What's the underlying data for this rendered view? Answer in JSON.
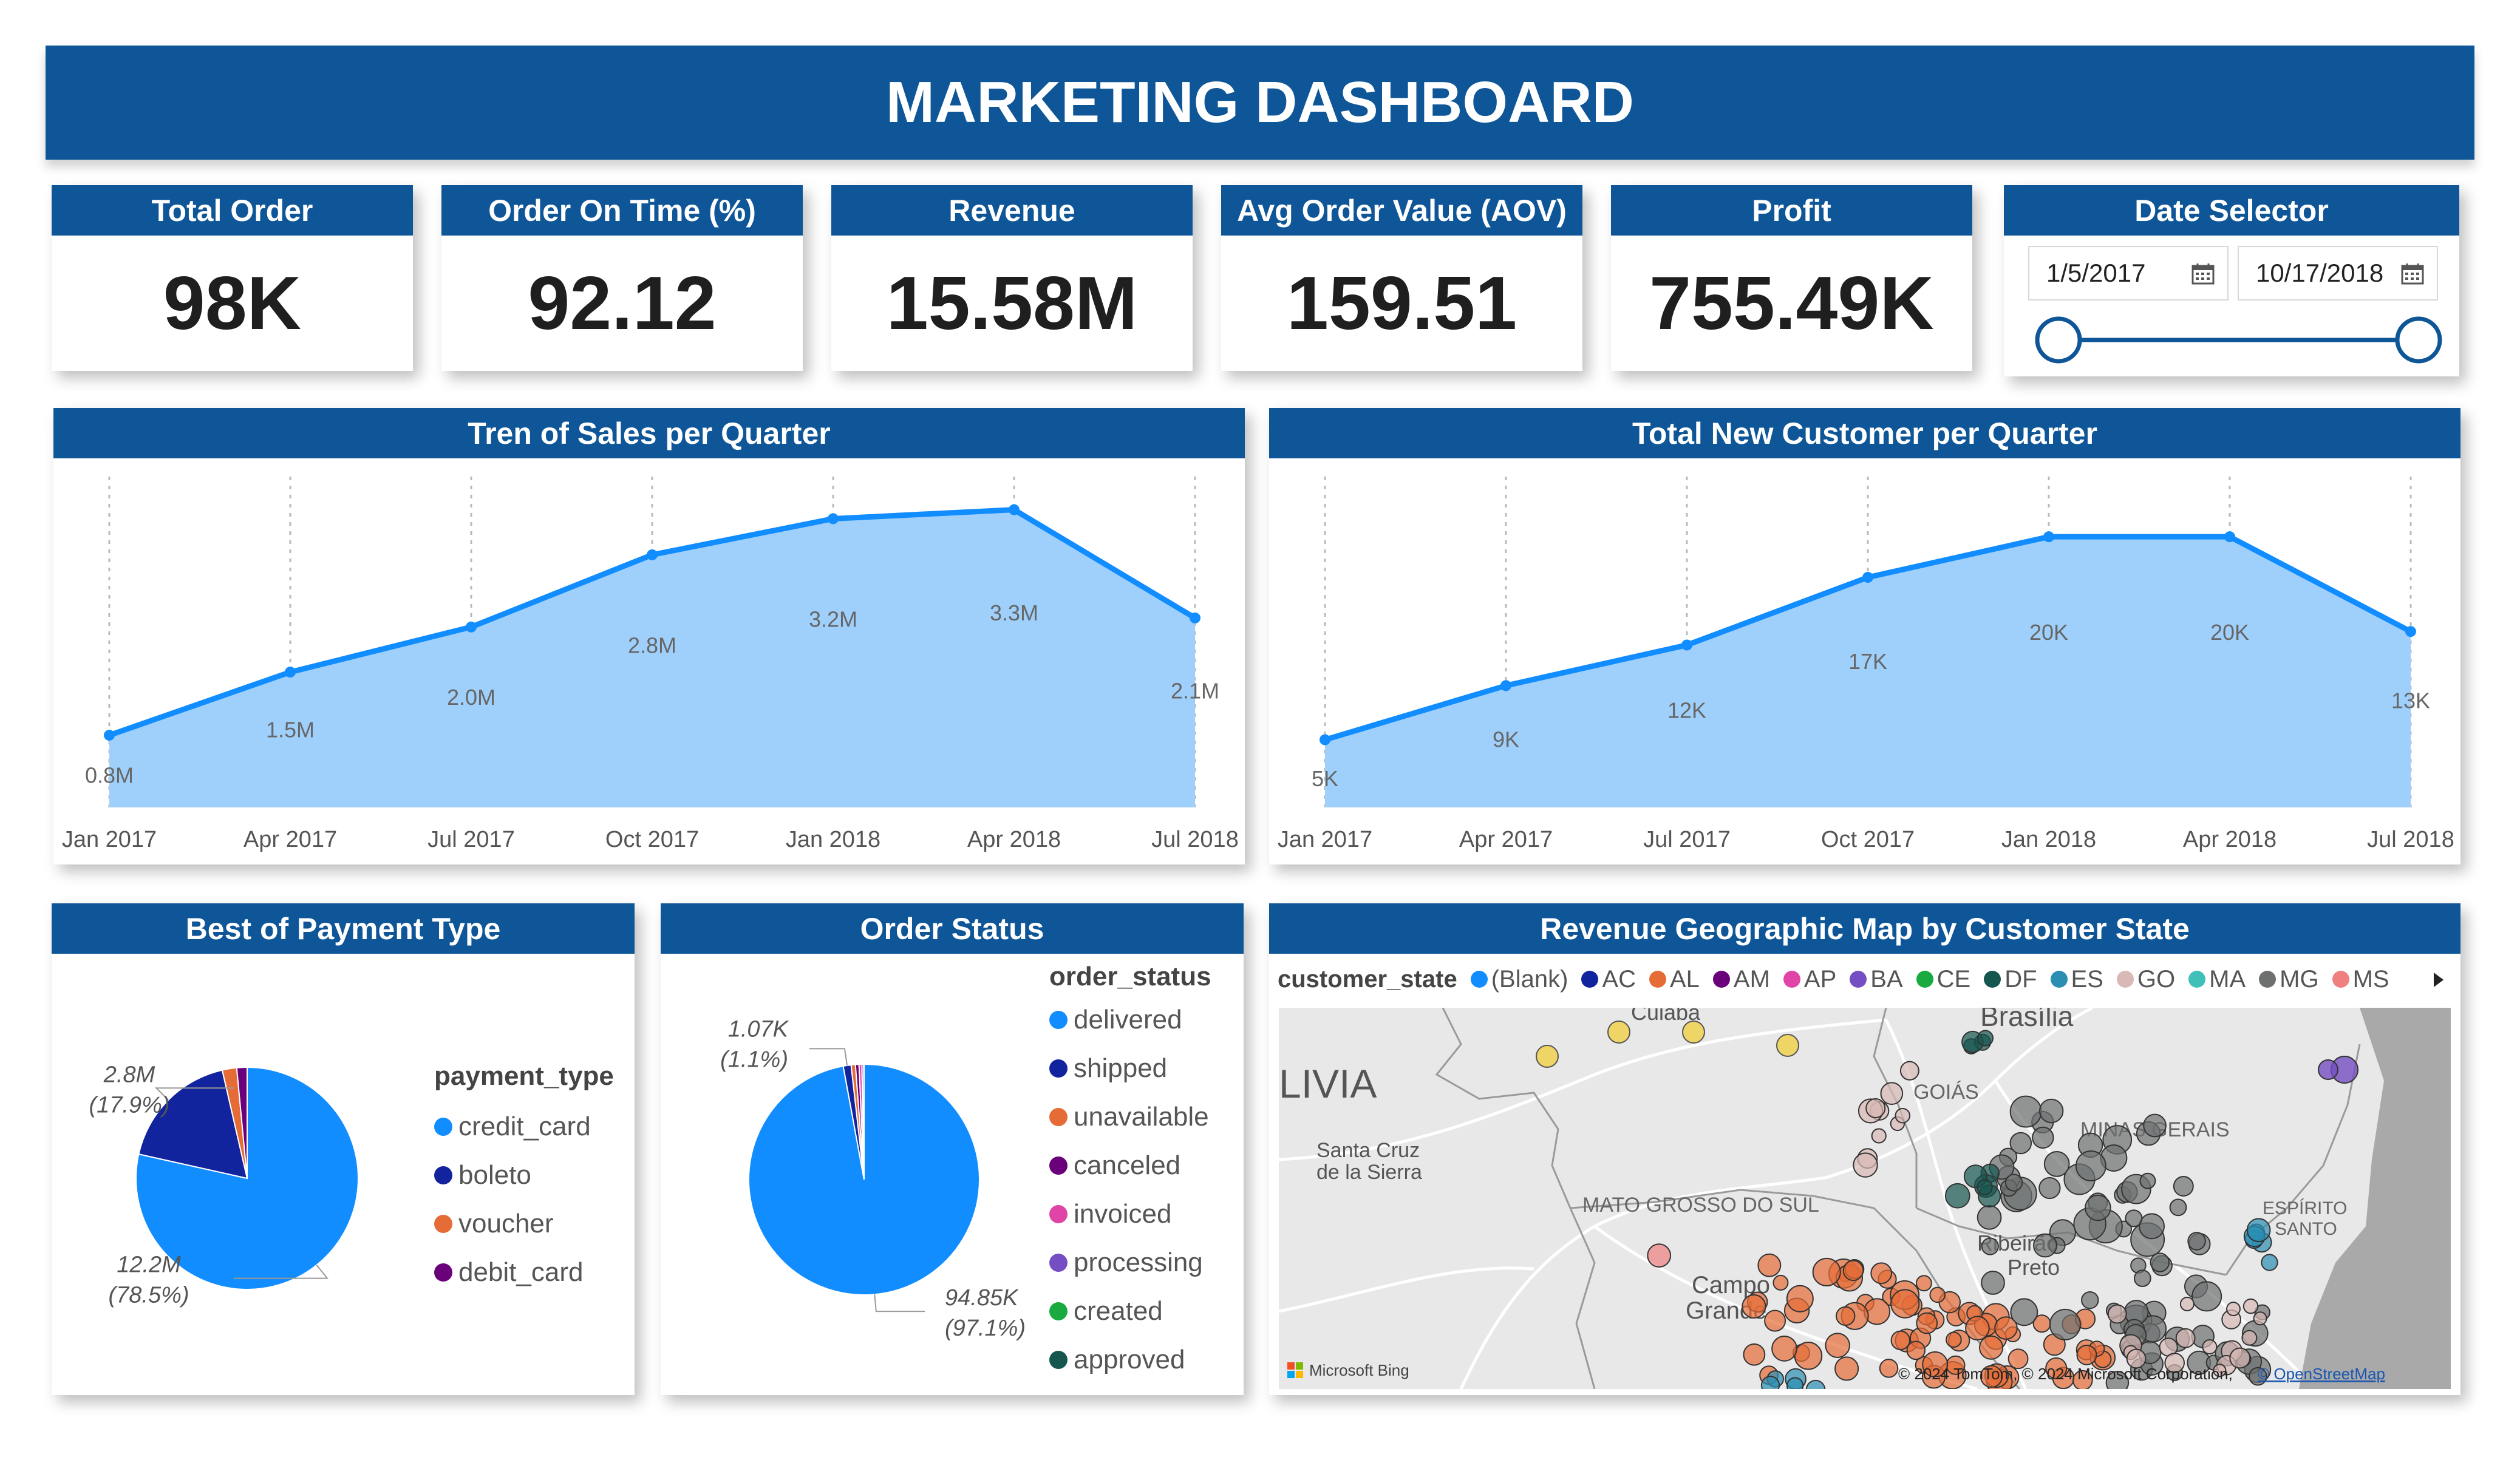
{
  "title": "MARKETING DASHBOARD",
  "kpis": [
    {
      "label": "Total Order",
      "value": "98K"
    },
    {
      "label": "Order On Time (%)",
      "value": "92.12"
    },
    {
      "label": "Revenue",
      "value": "15.58M"
    },
    {
      "label": "Avg Order Value (AOV)",
      "value": "159.51"
    },
    {
      "label": "Profit",
      "value": "755.49K"
    }
  ],
  "date_selector": {
    "label": "Date Selector",
    "start": "1/5/2017",
    "end": "10/17/2018",
    "icon": "calendar-icon"
  },
  "sales_chart": {
    "title": "Tren of Sales per Quarter"
  },
  "customer_chart": {
    "title": "Total New Customer per Quarter"
  },
  "payment": {
    "title": "Best of Payment Type",
    "legend_title": "payment_type"
  },
  "order_status": {
    "title": "Order Status",
    "legend_title": "order_status"
  },
  "map": {
    "title": "Revenue Geographic Map by Customer State",
    "legend_title": "customer_state",
    "legend": [
      {
        "label": "(Blank)",
        "color": "#118dff"
      },
      {
        "label": "AC",
        "color": "#12239e"
      },
      {
        "label": "AL",
        "color": "#e66c37"
      },
      {
        "label": "AM",
        "color": "#6b007b"
      },
      {
        "label": "AP",
        "color": "#e044a7"
      },
      {
        "label": "BA",
        "color": "#744ec2"
      },
      {
        "label": "CE",
        "color": "#1aab40"
      },
      {
        "label": "DF",
        "color": "#15564f"
      },
      {
        "label": "ES",
        "color": "#2b8fb4"
      },
      {
        "label": "GO",
        "color": "#d9b9b5"
      },
      {
        "label": "MA",
        "color": "#41c0b9"
      },
      {
        "label": "MG",
        "color": "#6e7070"
      },
      {
        "label": "MS",
        "color": "#f08080"
      }
    ],
    "places": [
      "Cuiabá",
      "Brasília",
      "LIVIA",
      "GOIÁS",
      "MINAS GERAIS",
      "Santa Cruz",
      "de la Sierra",
      "MATO GROSSO DO SUL",
      "Campo",
      "Grande",
      "ESPÍRITO",
      "SANTO",
      "Ribeirão",
      "Preto"
    ],
    "bing": "Microsoft Bing",
    "copyright": "© 2024 TomTom, © 2024 Microsoft Corporation,",
    "osm": "© OpenStreetMap"
  },
  "chart_data": [
    {
      "type": "area",
      "title": "Tren of Sales per Quarter",
      "x": [
        "Jan 2017",
        "Apr 2017",
        "Jul 2017",
        "Oct 2017",
        "Jan 2018",
        "Apr 2018",
        "Jul 2018"
      ],
      "values": [
        0.8,
        1.5,
        2.0,
        2.8,
        3.2,
        3.3,
        2.1
      ],
      "data_labels": [
        "0.8M",
        "1.5M",
        "2.0M",
        "2.8M",
        "3.2M",
        "3.3M",
        "2.1M"
      ],
      "ylim": [
        0,
        3.6
      ],
      "color": "#118dff",
      "fill": "#9fd0fb"
    },
    {
      "type": "area",
      "title": "Total New Customer per Quarter",
      "x": [
        "Jan 2017",
        "Apr 2017",
        "Jul 2017",
        "Oct 2017",
        "Jan 2018",
        "Apr 2018",
        "Jul 2018"
      ],
      "values": [
        5,
        9,
        12,
        17,
        20,
        20,
        13
      ],
      "data_labels": [
        "5K",
        "9K",
        "12K",
        "17K",
        "20K",
        "20K",
        "13K"
      ],
      "ylim": [
        0,
        24
      ],
      "color": "#118dff",
      "fill": "#9fd0fb"
    },
    {
      "type": "pie",
      "title": "Best of Payment Type",
      "categories": [
        "credit_card",
        "boleto",
        "voucher",
        "debit_card"
      ],
      "values": [
        78.5,
        17.9,
        2.1,
        1.5
      ],
      "colors": [
        "#118dff",
        "#12239e",
        "#e66c37",
        "#6b007b"
      ],
      "annotations": [
        {
          "value": "12.2M",
          "percent": "(78.5%)"
        },
        {
          "value": "2.8M",
          "percent": "(17.9%)"
        }
      ]
    },
    {
      "type": "pie",
      "title": "Order Status",
      "categories": [
        "delivered",
        "shipped",
        "unavailable",
        "canceled",
        "invoiced",
        "processing",
        "created",
        "approved"
      ],
      "values": [
        97.1,
        1.1,
        0.6,
        0.5,
        0.4,
        0.25,
        0.03,
        0.02
      ],
      "colors": [
        "#118dff",
        "#12239e",
        "#e66c37",
        "#6b007b",
        "#e044a7",
        "#744ec2",
        "#1aab40",
        "#15564f"
      ],
      "annotations": [
        {
          "value": "94.85K",
          "percent": "(97.1%)"
        },
        {
          "value": "1.07K",
          "percent": "(1.1%)"
        }
      ]
    }
  ]
}
